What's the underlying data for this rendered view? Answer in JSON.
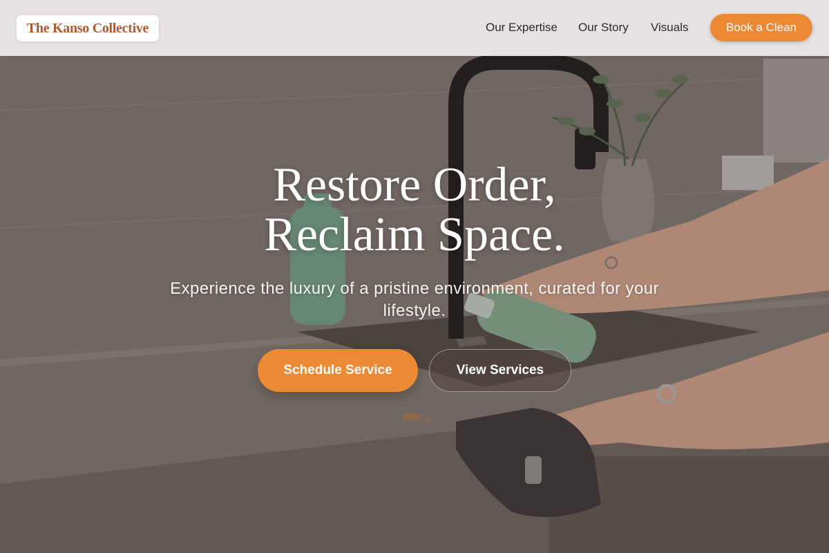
{
  "brand": {
    "name": "The Kanso Collective",
    "accent": "#ec8935",
    "logo_color": "#b2572a"
  },
  "nav": {
    "links": [
      {
        "label": "Our Expertise"
      },
      {
        "label": "Our Story"
      },
      {
        "label": "Visuals"
      }
    ],
    "cta_label": "Book a Clean"
  },
  "hero": {
    "headline_line1": "Restore Order,",
    "headline_line2": "Reclaim Space.",
    "subtitle": "Experience the luxury of a pristine environment, curated for your lifestyle.",
    "primary_button": "Schedule Service",
    "secondary_button": "View Services",
    "background_description_icon": "kitchen-cleaning-photo"
  }
}
